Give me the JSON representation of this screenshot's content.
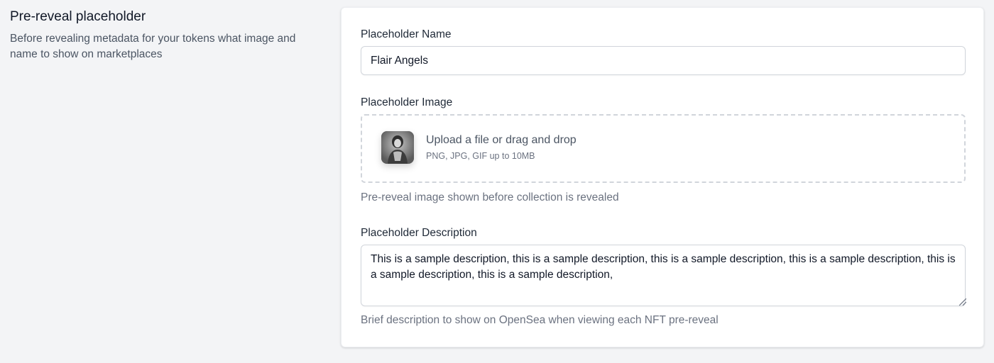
{
  "section": {
    "title": "Pre-reveal placeholder",
    "description": "Before revealing metadata for your tokens what image and name to show on marketplaces"
  },
  "form": {
    "name_field": {
      "label": "Placeholder Name",
      "value": "Flair Angels"
    },
    "image_field": {
      "label": "Placeholder Image",
      "upload_text": "Upload a file or drag and drop",
      "upload_hint": "PNG, JPG, GIF up to 10MB",
      "help": "Pre-reveal image shown before collection is revealed",
      "thumbnail_icon": "portrait-thumbnail"
    },
    "description_field": {
      "label": "Placeholder Description",
      "value": "This is a sample description, this is a sample description, this is a sample description, this is a sample description, this is a sample description, this is a sample description,",
      "help": "Brief description to show on OpenSea when viewing each NFT pre-reveal"
    }
  },
  "colors": {
    "page_background": "#f3f4f6",
    "card_background": "#ffffff",
    "border": "#d1d5db",
    "text_primary": "#111827",
    "text_secondary": "#6b7280"
  }
}
